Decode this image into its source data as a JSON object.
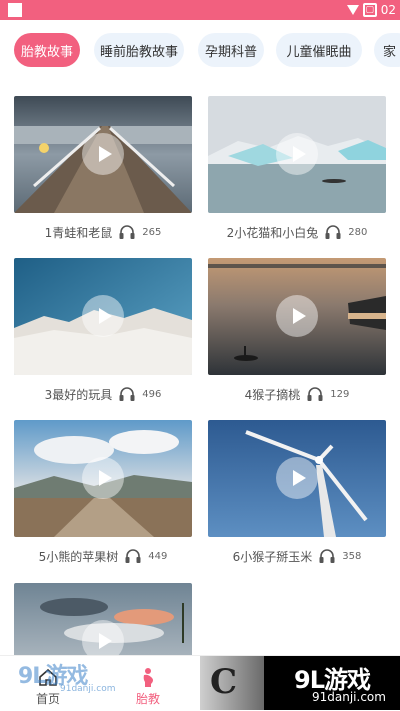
{
  "status_bar": {
    "time": "02",
    "accent": "#f2607f"
  },
  "tabs": [
    {
      "label": "胎教故事",
      "active": true
    },
    {
      "label": "睡前胎教故事",
      "active": false
    },
    {
      "label": "孕期科普",
      "active": false
    },
    {
      "label": "儿童催眠曲",
      "active": false
    },
    {
      "label": "家",
      "active": false
    }
  ],
  "stories": [
    {
      "title": "1青蛙和老鼠",
      "plays": "265",
      "scene": "pier"
    },
    {
      "title": "2小花猫和小白兔",
      "plays": "280",
      "scene": "glacier"
    },
    {
      "title": "3最好的玩具",
      "plays": "496",
      "scene": "snow-mountain"
    },
    {
      "title": "4猴子摘桃",
      "plays": "129",
      "scene": "lake-boat"
    },
    {
      "title": "5小熊的苹果树",
      "plays": "449",
      "scene": "desert-road"
    },
    {
      "title": "6小猴子掰玉米",
      "plays": "358",
      "scene": "wind-turbine"
    },
    {
      "title": "",
      "plays": "",
      "scene": "cloudy-sky"
    }
  ],
  "bottom_nav": [
    {
      "label": "首页",
      "icon": "home-icon",
      "active": false
    },
    {
      "label": "胎教",
      "icon": "mother-icon",
      "active": true
    }
  ],
  "watermarks": {
    "left_logo": "9L游戏",
    "left_url": "91danji.com",
    "right_logo": "9L游戏",
    "right_url": "91danji.com"
  }
}
